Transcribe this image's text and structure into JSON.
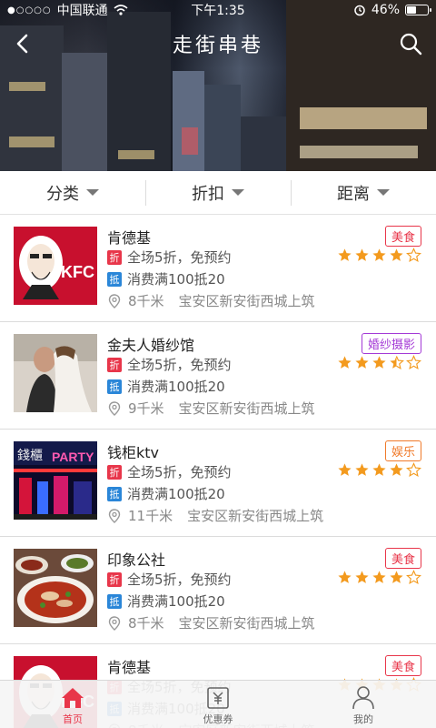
{
  "status_bar": {
    "carrier": "中国联通",
    "time": "下午1:35",
    "battery": "46%",
    "battery_level": 0.46
  },
  "header": {
    "title": "走街串巷",
    "back_icon": "chevron-left-icon",
    "search_icon": "search-icon"
  },
  "filters": [
    {
      "label": "分类"
    },
    {
      "label": "折扣"
    },
    {
      "label": "距离"
    }
  ],
  "badges": {
    "discount": "折",
    "voucher": "抵"
  },
  "items": [
    {
      "name": "肯德基",
      "discount": "全场5折，免预约",
      "voucher": "消费满100抵20",
      "distance": "8千米",
      "address": "宝安区新安街西城上筑",
      "category": "美食",
      "category_color": "#e8364a",
      "rating": 4,
      "thumb": "kfc-logo"
    },
    {
      "name": "金夫人婚纱馆",
      "discount": "全场5折，免预约",
      "voucher": "消费满100抵20",
      "distance": "9千米",
      "address": "宝安区新安街西城上筑",
      "category": "婚纱摄影",
      "category_color": "#a43ad6",
      "rating": 3.5,
      "thumb": "wedding-photo"
    },
    {
      "name": "钱柜ktv",
      "discount": "全场5折，免预约",
      "voucher": "消费满100抵20",
      "distance": "11千米",
      "address": "宝安区新安街西城上筑",
      "category": "娱乐",
      "category_color": "#f07a2a",
      "rating": 4,
      "thumb": "ktv-photo"
    },
    {
      "name": "印象公社",
      "discount": "全场5折，免预约",
      "voucher": "消费满100抵20",
      "distance": "8千米",
      "address": "宝安区新安街西城上筑",
      "category": "美食",
      "category_color": "#e8364a",
      "rating": 4,
      "thumb": "food-photo"
    },
    {
      "name": "肯德基",
      "discount": "全场5折，免预约",
      "voucher": "消费满100抵20",
      "distance": "8千米",
      "address": "宝安区新安街西城上筑",
      "category": "美食",
      "category_color": "#e8364a",
      "rating": 4,
      "thumb": "kfc-logo"
    }
  ],
  "tabbar": [
    {
      "label": "首页",
      "icon": "home-icon",
      "active": true
    },
    {
      "label": "优惠券",
      "icon": "coupon-icon",
      "active": false
    },
    {
      "label": "我的",
      "icon": "user-icon",
      "active": false
    }
  ],
  "colors": {
    "accent": "#e8364a",
    "star": "#f39a1e",
    "voucher_blue": "#2a86d8"
  }
}
